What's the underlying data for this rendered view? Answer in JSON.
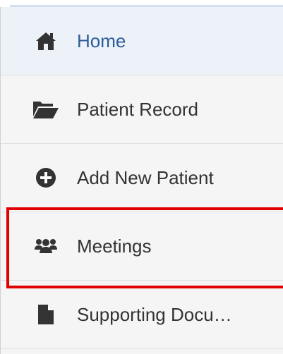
{
  "nav": {
    "items": [
      {
        "label": "Home",
        "icon": "home-icon",
        "active": true
      },
      {
        "label": "Patient Record",
        "icon": "folder-open-icon",
        "active": false
      },
      {
        "label": "Add New Patient",
        "icon": "plus-circle-icon",
        "active": false
      },
      {
        "label": "Meetings",
        "icon": "users-icon",
        "active": false
      },
      {
        "label": "Supporting Docu…",
        "icon": "file-icon",
        "active": false
      }
    ]
  },
  "colors": {
    "active_text": "#2b5d9a",
    "text": "#333333",
    "highlight_border": "#e00000",
    "background": "#f5f5f5"
  }
}
